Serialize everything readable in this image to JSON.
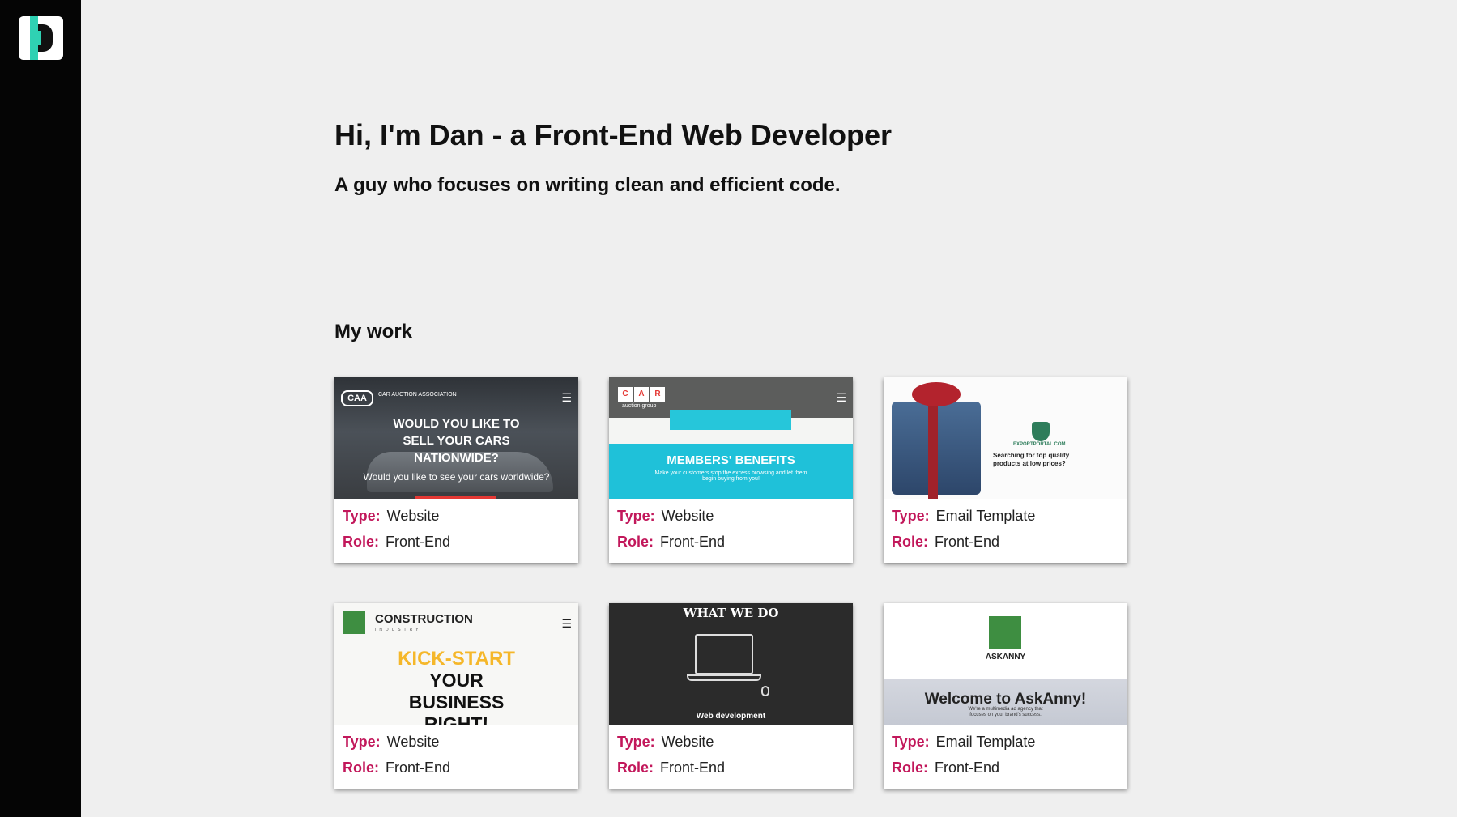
{
  "hero": {
    "title": "Hi, I'm Dan - a Front-End Web Developer",
    "subtitle": "A guy who focuses on writing clean and efficient code."
  },
  "work": {
    "heading": "My work",
    "type_label": "Type:",
    "role_label": "Role:",
    "cards": [
      {
        "type": "Website",
        "role": "Front-End",
        "thumb": {
          "brand": "CAA",
          "brand_sub": "CAR AUCTION ASSOCIATION",
          "headline": "WOULD YOU LIKE TO SELL YOUR CARS NATIONWIDE?",
          "subline": "Would you like to see your cars worldwide?"
        }
      },
      {
        "type": "Website",
        "role": "Front-End",
        "thumb": {
          "letters": [
            "C",
            "A",
            "R"
          ],
          "brand_sub": "auction group",
          "headline": "MEMBERS' BENEFITS",
          "subline": "Make your customers stop the excess browsing and let them begin buying from you!"
        }
      },
      {
        "type": "Email Template",
        "role": "Front-End",
        "thumb": {
          "brand": "EXPORTPORTAL.COM",
          "headline": "Searching for top quality products at low prices?"
        }
      },
      {
        "type": "Website",
        "role": "Front-End",
        "thumb": {
          "brand": "CONSTRUCTION",
          "brand_sub": "INDUSTRY",
          "headline_accent": "KICK-START",
          "headline": "YOUR BUSINESS RIGHT!"
        }
      },
      {
        "type": "Website",
        "role": "Front-End",
        "thumb": {
          "headline": "WHAT WE DO",
          "subline": "Web development"
        }
      },
      {
        "type": "Email Template",
        "role": "Front-End",
        "thumb": {
          "brand": "ASKANNY",
          "headline": "Welcome to AskAnny!",
          "subline": "We're a multimedia ad agency that focuses on your brand's success."
        }
      }
    ]
  },
  "colors": {
    "sidebar": "#050505",
    "accent_label": "#c2185b",
    "logo_teal": "#2fd1b3"
  }
}
